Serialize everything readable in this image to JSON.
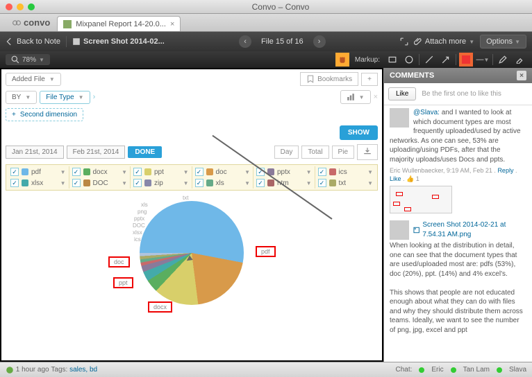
{
  "window": {
    "title": "Convo – Convo"
  },
  "app": {
    "logo": "convo",
    "tab_label": "Mixpanel Report 14-20.0..."
  },
  "toolbar": {
    "back_label": "Back to Note",
    "file_title": "Screen Shot 2014-02...",
    "file_count": "File 15 of 16",
    "attach_label": "Attach more",
    "options_label": "Options"
  },
  "subbar": {
    "zoom": "78%",
    "markup_label": "Markup:"
  },
  "mixpanel": {
    "added_file": "Added File",
    "by_label": "BY",
    "filetype_label": "File Type",
    "second_dim": "Second dimension",
    "bookmarks": "Bookmarks",
    "show": "SHOW",
    "date_from": "Jan 21st, 2014",
    "date_to": "Feb 21st, 2014",
    "done": "DONE",
    "seg_day": "Day",
    "seg_total": "Total",
    "seg_pie": "Pie",
    "filetypes_row1": [
      {
        "label": "pdf",
        "color": "#6fb8e8"
      },
      {
        "label": "docx",
        "color": "#5aae5f"
      },
      {
        "label": "ppt",
        "color": "#d8cf6a"
      },
      {
        "label": "doc",
        "color": "#d89a4a"
      },
      {
        "label": "pptx",
        "color": "#8a7a9a"
      },
      {
        "label": "ics",
        "color": "#c86a6a"
      }
    ],
    "filetypes_row2": [
      {
        "label": "xlsx",
        "color": "#4aa"
      },
      {
        "label": "DOC",
        "color": "#b84"
      },
      {
        "label": "zip",
        "color": "#88a"
      },
      {
        "label": "xls",
        "color": "#6a8"
      },
      {
        "label": "htm",
        "color": "#a66"
      },
      {
        "label": "txt",
        "color": "#aa6"
      }
    ],
    "annotations": {
      "pdf": "pdf",
      "docx": "docx",
      "ppt": "ppt",
      "doc": "doc"
    },
    "line_labels": [
      "txt",
      "xls",
      "png",
      "pptx",
      "DOC",
      "xlsx",
      "ics"
    ]
  },
  "chart_data": {
    "type": "pie",
    "title": "",
    "series": [
      {
        "name": "pdf",
        "value": 53,
        "color": "#6fb8e8"
      },
      {
        "name": "doc",
        "value": 20,
        "color": "#d89a4a"
      },
      {
        "name": "ppt",
        "value": 14,
        "color": "#d8cf6a"
      },
      {
        "name": "docx",
        "value": 4,
        "color": "#5aae5f"
      },
      {
        "name": "xlsx",
        "value": 3,
        "color": "#4aa"
      },
      {
        "name": "pptx",
        "value": 2,
        "color": "#8a7a9a"
      },
      {
        "name": "ics",
        "value": 1,
        "color": "#c86a6a"
      },
      {
        "name": "xls",
        "value": 1,
        "color": "#6a8"
      },
      {
        "name": "txt",
        "value": 1,
        "color": "#aa6"
      },
      {
        "name": "png",
        "value": 1,
        "color": "#b0c4de"
      }
    ]
  },
  "comments": {
    "header": "COMMENTS",
    "like_btn": "Like",
    "like_prompt": "Be the first one to like this",
    "c1": {
      "mention": "@Slava:",
      "text": " and I wanted to look at which document types are most frequently uploaded/used by active networks. As one can see, 53% are uploading/using PDFs, after that the majority uploads/uses Docs and ppts.",
      "meta_author": "Eric Wullenbaecker, 9:19 AM, Feb 21",
      "reply": "Reply",
      "like": "Like",
      "count": "1"
    },
    "c2": {
      "attach": "Screen Shot 2014-02-21 at 7.54.31 AM.png",
      "p1": "When looking at the distribution in detail, one can see that the document types that are used/uploaded most are: pdfs (53%), doc (20%), ppt. (14%) and 4% excel's.",
      "p2": "This shows that people are not educated enough about what they can do with files and why they should distribute them across teams. Ideally, we want to see the number of png, jpg, excel and ppt"
    }
  },
  "status": {
    "time": "1 hour ago",
    "tags_label": "Tags:",
    "tags": "sales, bd",
    "chat_label": "Chat:",
    "users": [
      "Eric",
      "Tan Lam",
      "Slava"
    ]
  }
}
